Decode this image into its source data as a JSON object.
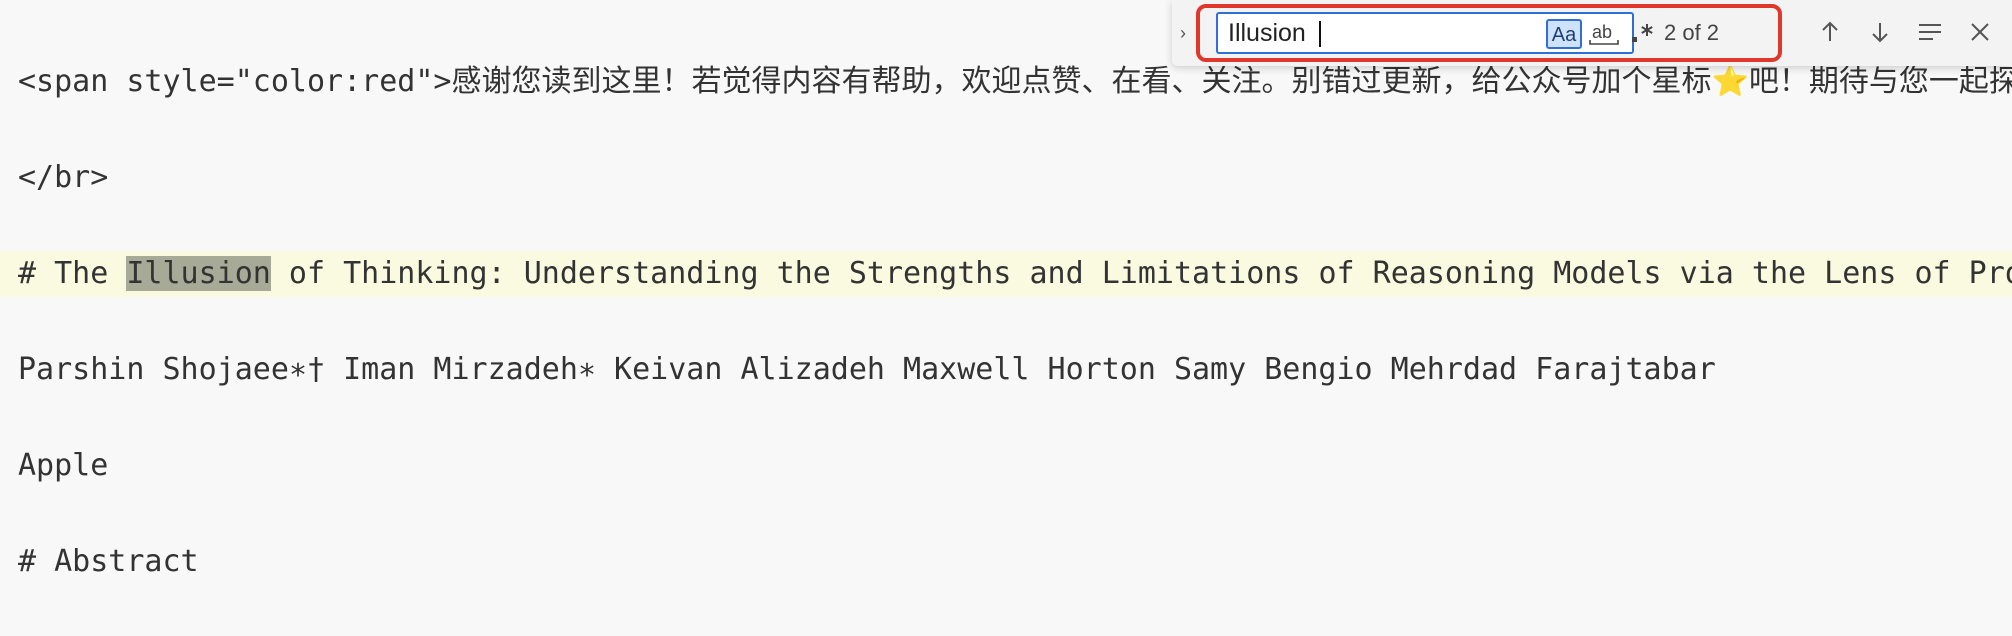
{
  "editor": {
    "lines": [
      "<span style=\"color:red\">感谢您读到这里！若觉得内容有帮助，欢迎点赞、在看、关注。别错过更新，给公众号加个星标⭐吧！期待与您一起探索AI技术与实践！</span>",
      "</br>",
      "# The ",
      "Parshin Shojaee∗† Iman Mirzadeh∗ Keivan Alizadeh Maxwell Horton Samy Bengio Mehrdad Farajtabar",
      "Apple",
      "# Abstract"
    ],
    "title_match": "Illusion",
    "title_rest": " of Thinking: Understanding the Strengths and Limitations of Reasoning Models via the Lens of Problem Complexity"
  },
  "find_widget": {
    "query": "Illusion",
    "match_case_label": "Aa",
    "whole_word_label": "ab",
    "regex_label": ".*",
    "match_count": "2 of 2"
  },
  "icons": {
    "expand": "chevron-right-icon",
    "prev": "arrow-up-icon",
    "next": "arrow-down-icon",
    "in_selection": "find-in-selection-icon",
    "close": "close-icon"
  },
  "colors": {
    "background": "#f8f8f8",
    "current_line": "#fafae0",
    "match_highlight": "#a7aa96",
    "focus_border": "#2f6fd6",
    "annotation_red": "#e0372c"
  }
}
